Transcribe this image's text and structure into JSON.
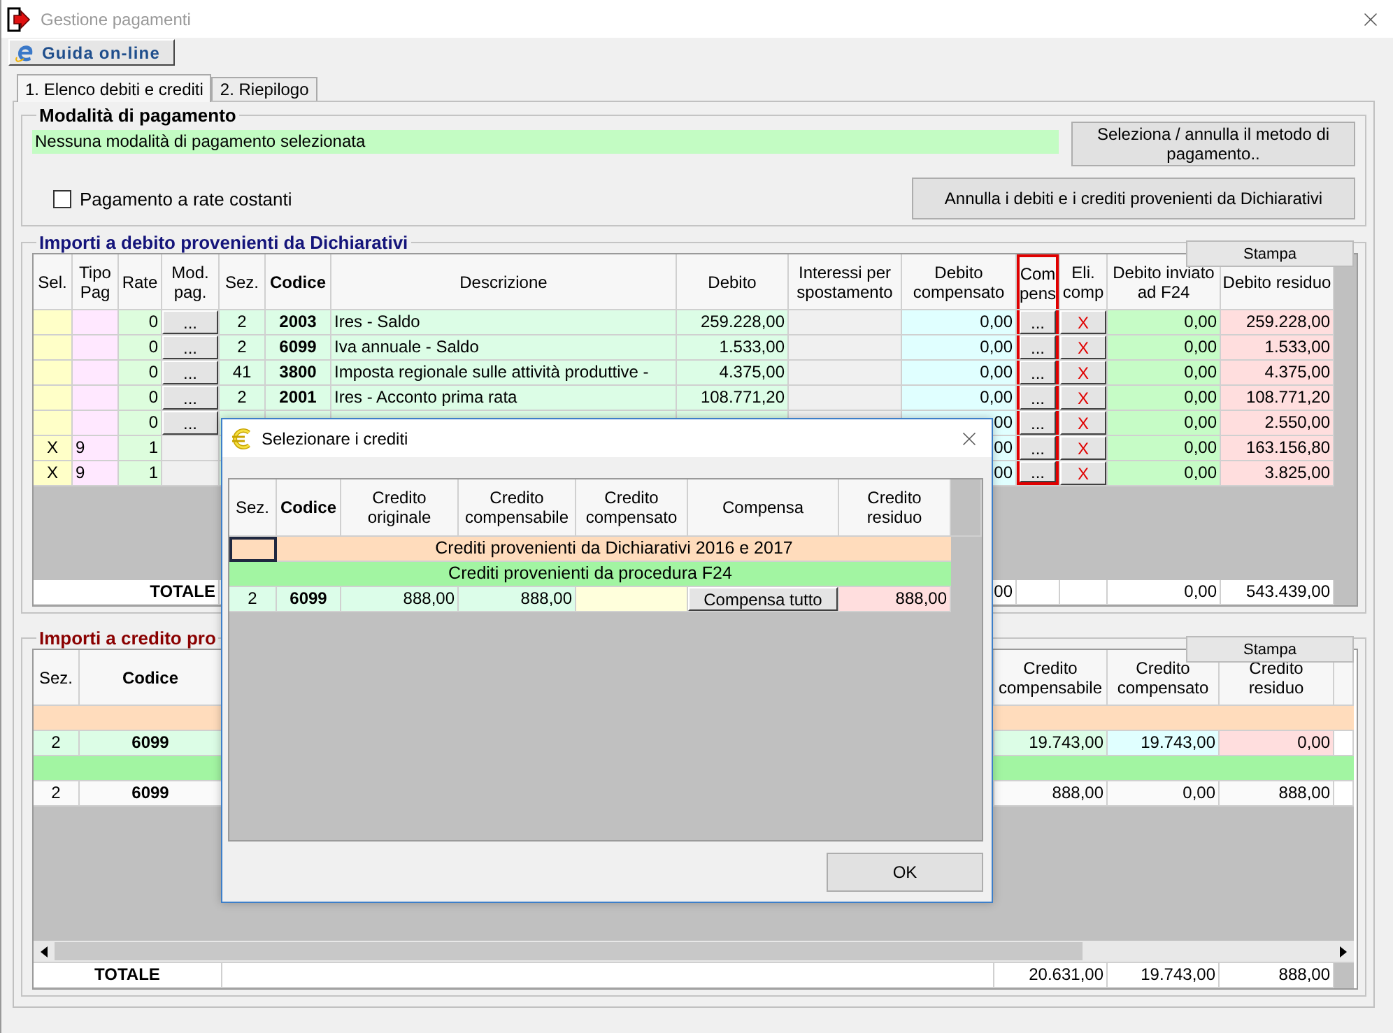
{
  "window": {
    "title": "Gestione pagamenti"
  },
  "help_button": "Guida on-line",
  "tabs": [
    {
      "label": "1. Elenco debiti e crediti",
      "selected": true
    },
    {
      "label": "2. Riepilogo",
      "selected": false
    }
  ],
  "payment_method": {
    "title": "Modalità di pagamento",
    "status": "Nessuna modalità di pagamento selezionata",
    "select_button": "Seleziona / annulla il metodo di pagamento..",
    "installments": {
      "label": "Pagamento a rate costanti",
      "checked": false
    },
    "cancel_button": "Annulla i debiti e i crediti provenienti da Dichiarativi"
  },
  "debit_section": {
    "title": "Importi a debito provenienti da Dichiarativi",
    "print_button": "Stampa",
    "columns": [
      {
        "label": "Sel.",
        "kind": "text",
        "bold": false,
        "highlighted": false
      },
      {
        "label": "Tipo Pag",
        "kind": "text",
        "bold": false,
        "highlighted": false
      },
      {
        "label": "Rate",
        "kind": "text",
        "bold": false,
        "highlighted": false
      },
      {
        "label": "Mod. pag.",
        "kind": "button",
        "bold": false,
        "highlighted": false
      },
      {
        "label": "Sez.",
        "kind": "text",
        "bold": false,
        "highlighted": false
      },
      {
        "label": "Codice",
        "kind": "text",
        "bold": true,
        "highlighted": false
      },
      {
        "label": "Descrizione",
        "kind": "text",
        "bold": false,
        "highlighted": false
      },
      {
        "label": "Debito",
        "kind": "text",
        "bold": false,
        "highlighted": false
      },
      {
        "label": "Interessi per spostamento",
        "kind": "text",
        "bold": false,
        "highlighted": false
      },
      {
        "label": "Debito compensato",
        "kind": "text",
        "bold": false,
        "highlighted": false
      },
      {
        "label": "Compens",
        "kind": "button",
        "bold": false,
        "highlighted": true
      },
      {
        "label": "Eli. comp",
        "kind": "delete",
        "bold": false,
        "highlighted": false
      },
      {
        "label": "Debito inviato ad F24",
        "kind": "text",
        "bold": false,
        "highlighted": false
      },
      {
        "label": "Debito residuo",
        "kind": "text",
        "bold": false,
        "highlighted": false
      }
    ],
    "rows": [
      {
        "cells": [
          null,
          null,
          "0",
          "...",
          "2",
          "2003",
          "Ires - Saldo",
          "259.228,00",
          null,
          "0,00",
          "...",
          "X",
          "0,00",
          "259.228,00"
        ]
      },
      {
        "cells": [
          null,
          null,
          "0",
          "...",
          "2",
          "6099",
          "Iva annuale - Saldo",
          "1.533,00",
          null,
          "0,00",
          "...",
          "X",
          "0,00",
          "1.533,00"
        ]
      },
      {
        "cells": [
          null,
          null,
          "0",
          "...",
          "41",
          "3800",
          "Imposta regionale sulle attività produttive -",
          "4.375,00",
          null,
          "0,00",
          "...",
          "X",
          "0,00",
          "4.375,00"
        ]
      },
      {
        "cells": [
          null,
          null,
          "0",
          "...",
          "2",
          "2001",
          "Ires - Acconto prima rata",
          "108.771,20",
          null,
          "0,00",
          "...",
          "X",
          "0,00",
          "108.771,20"
        ]
      },
      {
        "cells": [
          null,
          null,
          "0",
          "...",
          null,
          null,
          null,
          null,
          null,
          "00",
          "...",
          "X",
          "0,00",
          "2.550,00"
        ]
      },
      {
        "cells": [
          "X",
          "9",
          "1",
          null,
          null,
          null,
          null,
          null,
          null,
          "00",
          "...",
          "X",
          "0,00",
          "163.156,80"
        ]
      },
      {
        "cells": [
          "X",
          "9",
          "1",
          null,
          null,
          null,
          null,
          null,
          null,
          "00",
          "...",
          "X",
          "0,00",
          "3.825,00"
        ]
      }
    ],
    "total": {
      "label": "TOTALE",
      "cells": [
        null,
        null,
        null,
        null,
        null,
        "00",
        null,
        null,
        "0,00",
        "543.439,00"
      ]
    }
  },
  "credit_section": {
    "title": "Importi a credito pro",
    "print_button": "Stampa",
    "columns": [
      {
        "label": "Sez.",
        "bold": false
      },
      {
        "label": "Codice",
        "bold": true
      },
      {
        "label": "Credito compensabile",
        "bold": false
      },
      {
        "label": "Credito compensato",
        "bold": false
      },
      {
        "label": "Credito residuo",
        "bold": false
      }
    ],
    "rows": [
      {
        "kind": "group",
        "color": "#ffdcbc"
      },
      {
        "kind": "data",
        "cells": [
          "2",
          "6099",
          "19.743,00",
          "19.743,00",
          "0,00"
        ]
      },
      {
        "kind": "group",
        "color": "#a2f5a2"
      },
      {
        "kind": "plain",
        "cells": [
          "2",
          "6099",
          "888,00",
          "0,00",
          "888,00"
        ]
      }
    ],
    "total": {
      "label": "TOTALE",
      "cells": [
        "20.631,00",
        "19.743,00",
        "888,00"
      ]
    }
  },
  "dialog": {
    "title": "Selezionare i crediti",
    "columns": [
      {
        "label": "Sez.",
        "kind": "text",
        "bold": false
      },
      {
        "label": "Codice",
        "kind": "text",
        "bold": true
      },
      {
        "label": "Credito originale",
        "kind": "text",
        "bold": false
      },
      {
        "label": "Credito compensabile",
        "kind": "text",
        "bold": false
      },
      {
        "label": "Credito compensato",
        "kind": "text",
        "bold": false
      },
      {
        "label": "Compensa",
        "kind": "button",
        "bold": false
      },
      {
        "label": "Credito residuo",
        "kind": "text",
        "bold": false
      }
    ],
    "rows": [
      {
        "kind": "group",
        "color": "#ffdcbc",
        "focused": true,
        "label": "Crediti provenienti da Dichiarativi 2016 e 2017"
      },
      {
        "kind": "group",
        "color": "#a2f5a2",
        "focused": false,
        "label": "Crediti provenienti da procedura F24"
      },
      {
        "kind": "data",
        "cells": [
          "2",
          "6099",
          "888,00",
          "888,00",
          null,
          "Compensa tutto",
          "888,00"
        ]
      }
    ],
    "ok_button": "OK"
  }
}
